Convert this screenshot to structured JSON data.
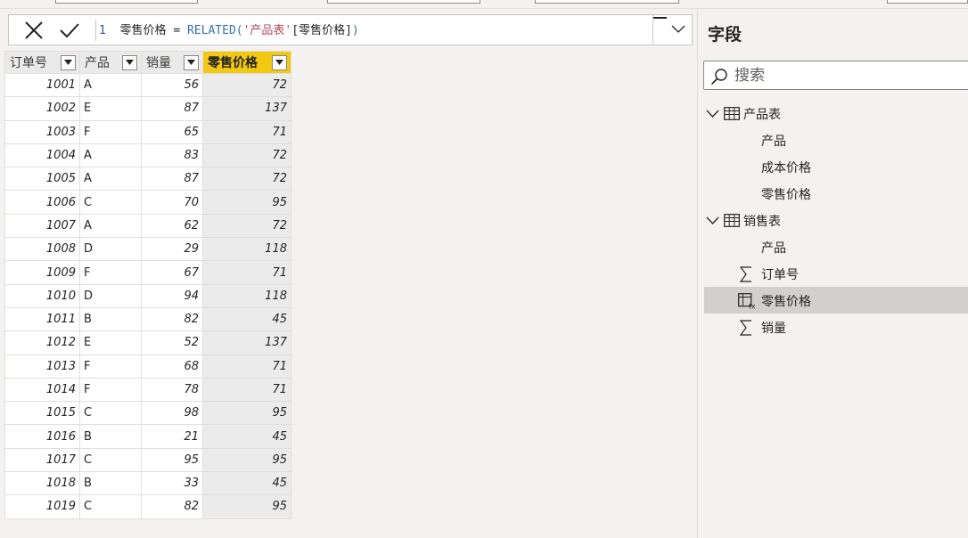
{
  "formula": {
    "line_number": "1",
    "column_name": "零售价格",
    "operator": "=",
    "function": "RELATED",
    "paren_open": "(",
    "table_ref": "'产品表'",
    "column_ref": "[零售价格]",
    "paren_close": ")"
  },
  "table": {
    "headers": [
      "订单号",
      "产品",
      "销量",
      "零售价格"
    ],
    "rows": [
      [
        "1001",
        "A",
        "56",
        "72"
      ],
      [
        "1002",
        "E",
        "87",
        "137"
      ],
      [
        "1003",
        "F",
        "65",
        "71"
      ],
      [
        "1004",
        "A",
        "83",
        "72"
      ],
      [
        "1005",
        "A",
        "87",
        "72"
      ],
      [
        "1006",
        "C",
        "70",
        "95"
      ],
      [
        "1007",
        "A",
        "62",
        "72"
      ],
      [
        "1008",
        "D",
        "29",
        "118"
      ],
      [
        "1009",
        "F",
        "67",
        "71"
      ],
      [
        "1010",
        "D",
        "94",
        "118"
      ],
      [
        "1011",
        "B",
        "82",
        "45"
      ],
      [
        "1012",
        "E",
        "52",
        "137"
      ],
      [
        "1013",
        "F",
        "68",
        "71"
      ],
      [
        "1014",
        "F",
        "78",
        "71"
      ],
      [
        "1015",
        "C",
        "98",
        "95"
      ],
      [
        "1016",
        "B",
        "21",
        "45"
      ],
      [
        "1017",
        "C",
        "95",
        "95"
      ],
      [
        "1018",
        "B",
        "33",
        "45"
      ],
      [
        "1019",
        "C",
        "82",
        "95"
      ]
    ]
  },
  "fields_pane": {
    "title": "字段",
    "search_placeholder": "搜索",
    "tables": [
      {
        "name": "产品表",
        "icon": "table-icon",
        "fields": [
          {
            "name": "产品",
            "icon": ""
          },
          {
            "name": "成本价格",
            "icon": ""
          },
          {
            "name": "零售价格",
            "icon": ""
          }
        ]
      },
      {
        "name": "销售表",
        "icon": "table-icon",
        "fields": [
          {
            "name": "产品",
            "icon": ""
          },
          {
            "name": "订单号",
            "icon": "sigma-icon"
          },
          {
            "name": "零售价格",
            "icon": "calculated-column-icon",
            "selected": true
          },
          {
            "name": "销量",
            "icon": "sigma-icon"
          }
        ]
      }
    ]
  },
  "colors": {
    "selected_header": "#f2c811",
    "selected_row": "#d2d0ce",
    "background": "#f3f2f1"
  }
}
